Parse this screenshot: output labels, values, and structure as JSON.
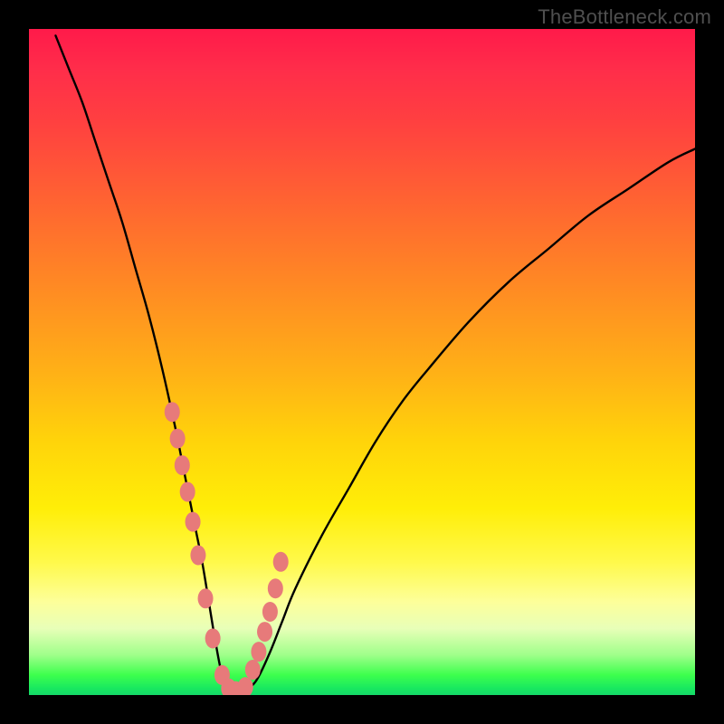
{
  "watermark": "TheBottleneck.com",
  "colors": {
    "background": "#000000",
    "curve": "#000000",
    "marker": "#e77a7a",
    "gradient_top": "#ff1a4a",
    "gradient_bottom": "#15d968"
  },
  "chart_data": {
    "type": "line",
    "title": "",
    "xlabel": "",
    "ylabel": "",
    "xlim": [
      0,
      100
    ],
    "ylim": [
      0,
      100
    ],
    "series": [
      {
        "name": "bottleneck-curve",
        "x": [
          4,
          6,
          8,
          10,
          12,
          14,
          16,
          18,
          20,
          22,
          23,
          24,
          25,
          26,
          27,
          28,
          29,
          30,
          31,
          32,
          34,
          36,
          38,
          40,
          44,
          48,
          52,
          56,
          60,
          66,
          72,
          78,
          84,
          90,
          96,
          100
        ],
        "values": [
          99,
          94,
          89,
          83,
          77,
          71,
          64,
          57,
          49,
          40,
          35,
          30,
          25,
          20,
          14,
          8,
          3,
          1,
          0.5,
          0.5,
          2,
          6,
          11,
          16,
          24,
          31,
          38,
          44,
          49,
          56,
          62,
          67,
          72,
          76,
          80,
          82
        ]
      }
    ],
    "markers": {
      "name": "highlight-points",
      "x": [
        21.5,
        22.3,
        23.0,
        23.8,
        24.6,
        25.4,
        26.5,
        27.6,
        29.0,
        30.0,
        31.0,
        32.5,
        33.6,
        34.5,
        35.4,
        36.2,
        37.0,
        37.8
      ],
      "values": [
        42.5,
        38.5,
        34.5,
        30.5,
        26.0,
        21.0,
        14.5,
        8.5,
        3.0,
        1.0,
        0.6,
        1.2,
        3.8,
        6.5,
        9.5,
        12.5,
        16.0,
        20.0
      ]
    }
  }
}
